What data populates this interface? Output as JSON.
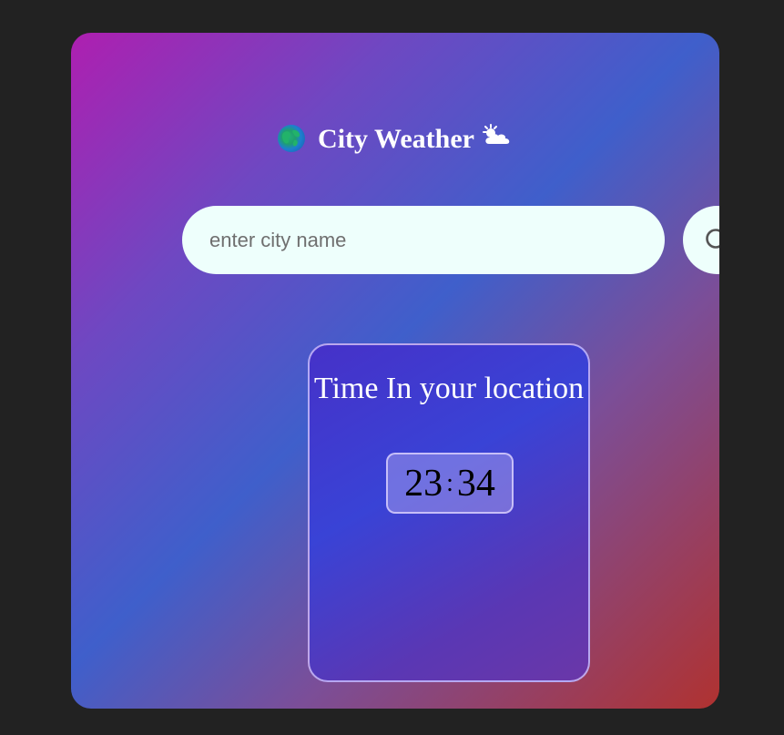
{
  "header": {
    "title": "City Weather",
    "left_icon": "globe-icon",
    "right_icon": "sun-behind-cloud-icon"
  },
  "search": {
    "placeholder": "enter city name",
    "value": "",
    "button_icon": "search-icon"
  },
  "time_card": {
    "heading": "Time In your location",
    "hours": "23",
    "separator": ":",
    "minutes": "34"
  },
  "colors": {
    "page_background": "#222222",
    "card_gradient": [
      "#ae1fb0",
      "#3f5fcb",
      "#b03230"
    ],
    "input_background": "#eefffc",
    "text": "#ffffff"
  }
}
